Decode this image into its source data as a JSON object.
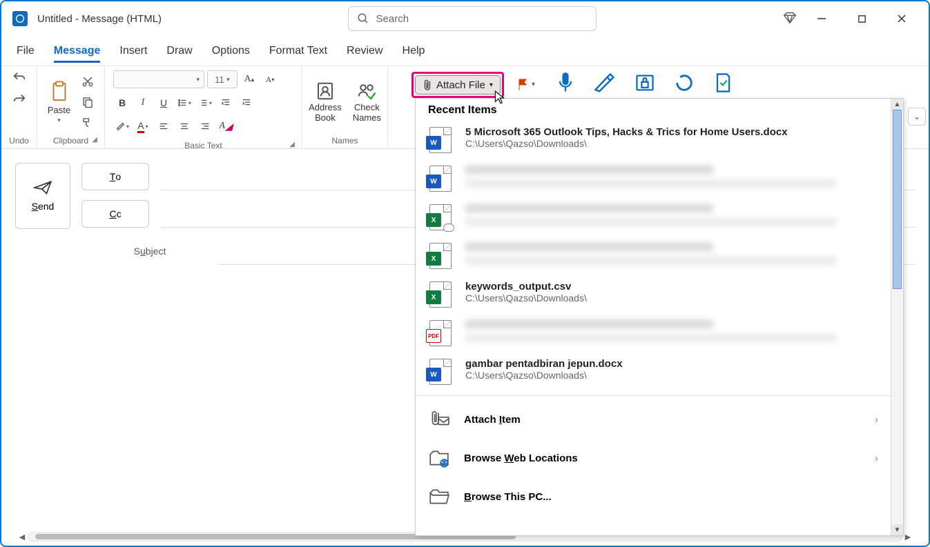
{
  "title": "Untitled  -  Message (HTML)",
  "search": {
    "placeholder": "Search"
  },
  "menubar": [
    "File",
    "Message",
    "Insert",
    "Draw",
    "Options",
    "Format Text",
    "Review",
    "Help"
  ],
  "menubar_active_index": 1,
  "ribbon": {
    "undo_label": "Undo",
    "clipboard_label": "Clipboard",
    "paste_label": "Paste",
    "basictext_label": "Basic Text",
    "font_size": "11",
    "names_label": "Names",
    "address_book": "Address Book",
    "check_names": "Check Names",
    "attach_file": "Attach File"
  },
  "compose": {
    "send": "Send",
    "to": "To",
    "cc": "Cc",
    "subject": "Subject"
  },
  "dropdown": {
    "heading": "Recent Items",
    "items": [
      {
        "type": "word",
        "name": "5 Microsoft 365 Outlook Tips, Hacks & Trics for Home Users.docx",
        "path": "C:\\Users\\Qazso\\Downloads\\",
        "blurred": false
      },
      {
        "type": "word",
        "name": "",
        "path": "",
        "blurred": true
      },
      {
        "type": "excel",
        "name": "",
        "path": "",
        "blurred": true,
        "cloud": true
      },
      {
        "type": "excel",
        "name": "",
        "path": "",
        "blurred": true
      },
      {
        "type": "excel",
        "name": "keywords_output.csv",
        "path": "C:\\Users\\Qazso\\Downloads\\",
        "blurred": false
      },
      {
        "type": "pdf",
        "name": "",
        "path": "",
        "blurred": true
      },
      {
        "type": "word",
        "name": "gambar pentadbiran jepun.docx",
        "path": "C:\\Users\\Qazso\\Downloads\\",
        "blurred": false
      }
    ],
    "attach_item": "Attach Item",
    "browse_web": "Browse Web Locations",
    "browse_pc": "Browse This PC..."
  }
}
